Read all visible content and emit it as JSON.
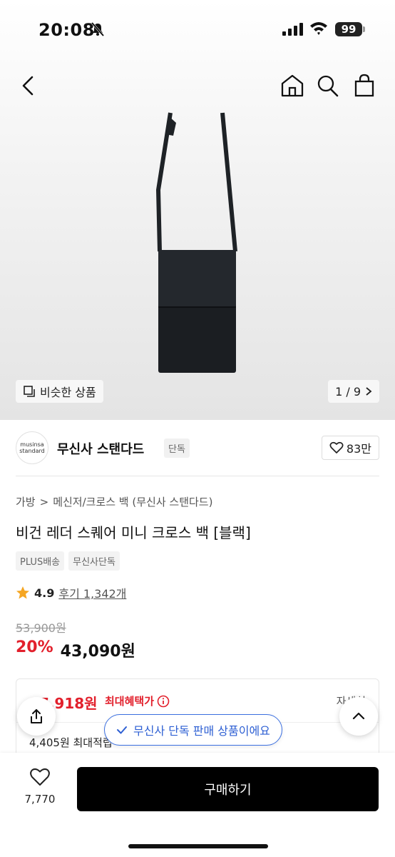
{
  "status_bar": {
    "time": "20:08",
    "battery": "99"
  },
  "gallery": {
    "similar_label": "비슷한 상품",
    "pager": "1 / 9"
  },
  "brand": {
    "logo_line1": "musinsa",
    "logo_line2": "standard",
    "name": "무신사 스탠다드",
    "tag": "단독",
    "likes": "83만"
  },
  "breadcrumb": {
    "category": "가방",
    "separator": ">",
    "subcategory": "메신저/크로스 백 (무신사 스탠다드)"
  },
  "product": {
    "title": "비건 레더 스퀘어 미니 크로스 백 [블랙]",
    "badges": [
      "PLUS배송",
      "무신사단독"
    ],
    "rating": "4.9",
    "reviews": "후기 1,342개",
    "original_price": "53,900원",
    "discount": "20%",
    "price": "43,090원"
  },
  "benefit": {
    "max_price": "37,918원",
    "max_label": "최대혜택가",
    "detail": "자세히",
    "points": "4,405원 최대적립"
  },
  "toast": {
    "message": "무신사 단독 판매 상품이에요"
  },
  "bottom_bar": {
    "wish_count": "7,770",
    "buy_label": "구매하기"
  },
  "colors": {
    "accent_red": "#e2202c",
    "toast_blue": "#2d5fd3",
    "star": "#f5a623"
  }
}
